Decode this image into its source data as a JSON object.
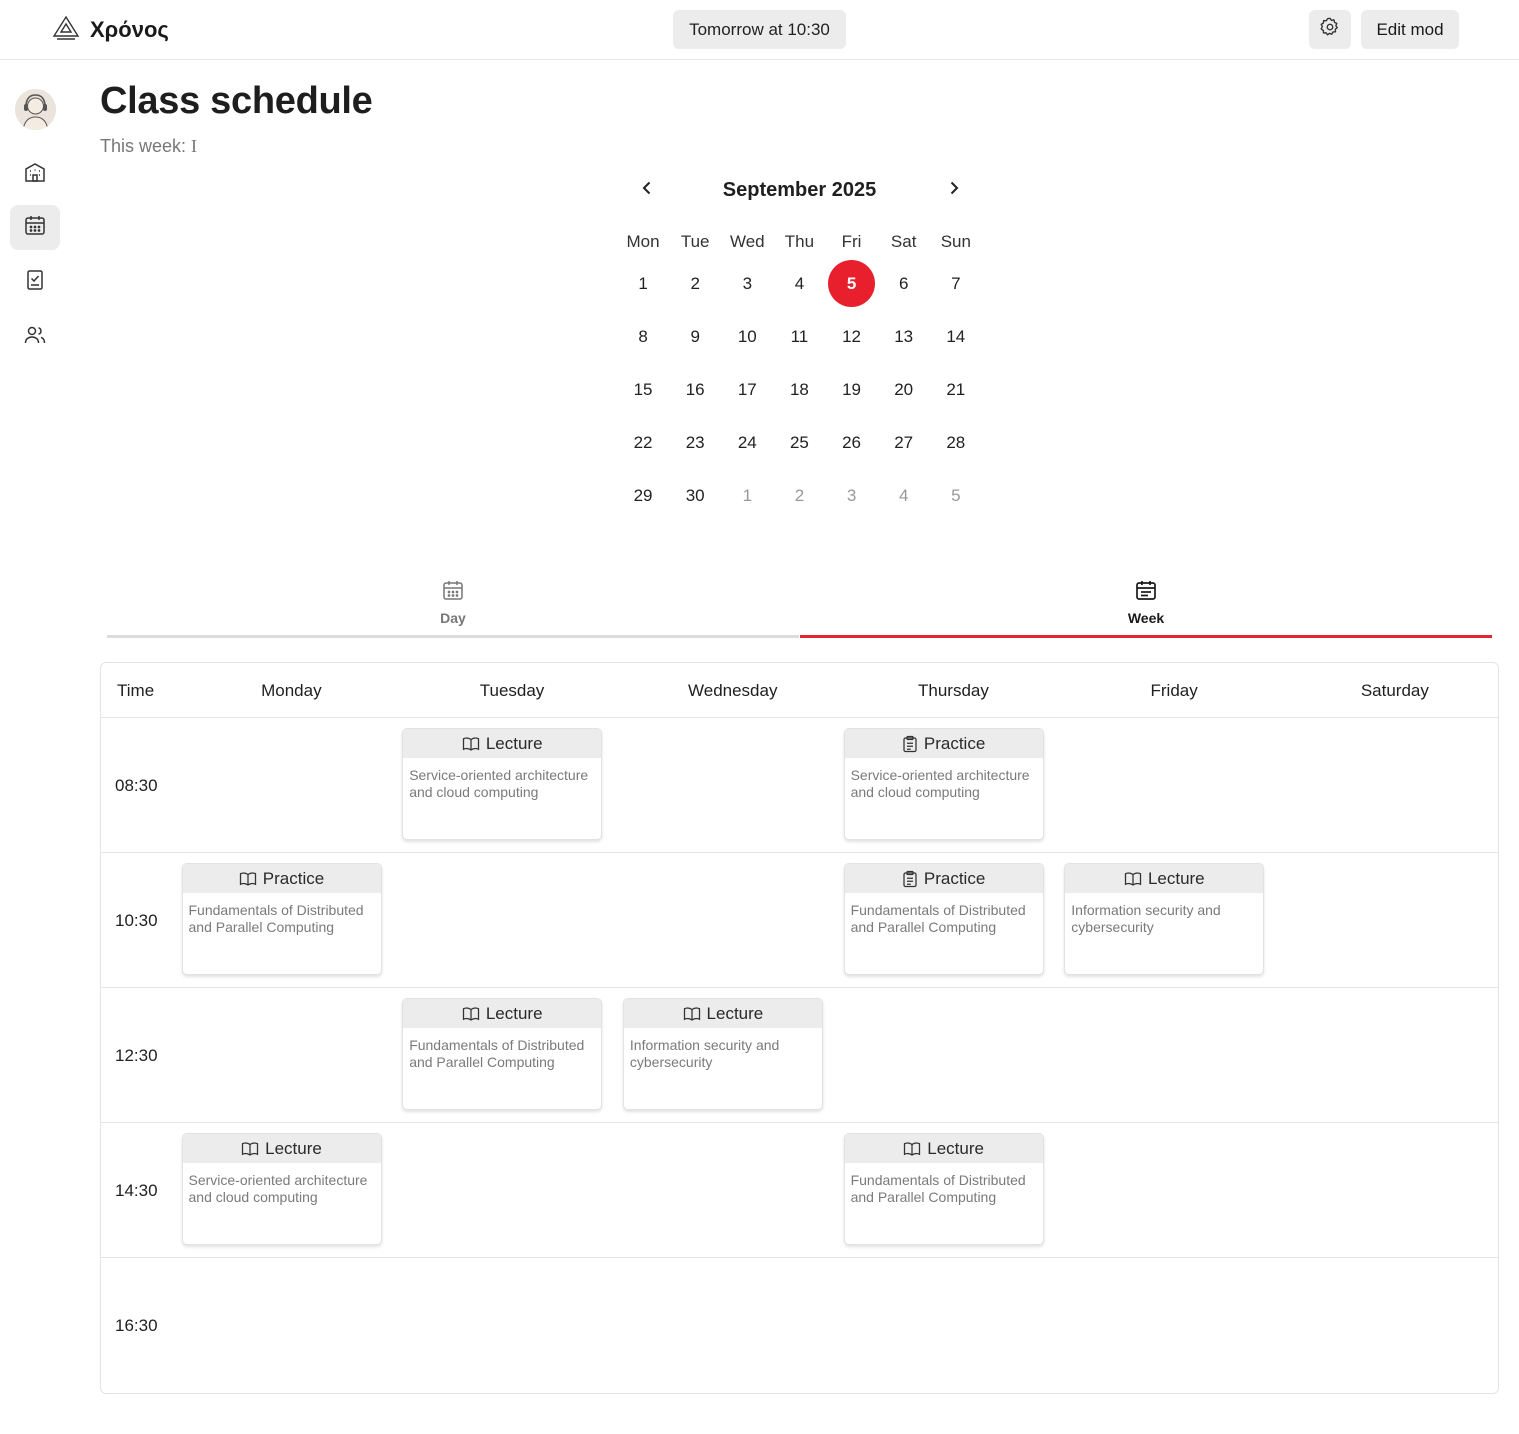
{
  "header": {
    "brand": "Χρόνος",
    "next_class": "Tomorrow at 10:30",
    "edit_label": "Edit mod"
  },
  "sidebar": {
    "items": [
      {
        "name": "buildings",
        "icon": "building-icon",
        "active": false
      },
      {
        "name": "schedule",
        "icon": "calendar-icon",
        "active": true
      },
      {
        "name": "tasks",
        "icon": "checklist-icon",
        "active": false
      },
      {
        "name": "people",
        "icon": "users-icon",
        "active": false
      }
    ]
  },
  "page": {
    "title": "Class schedule",
    "week_label": "This week:",
    "week_value": "I"
  },
  "calendar": {
    "month": "September 2025",
    "weekdays": [
      "Mon",
      "Tue",
      "Wed",
      "Thu",
      "Fri",
      "Sat",
      "Sun"
    ],
    "weeks": [
      [
        "1",
        "2",
        "3",
        "4",
        "5",
        "6",
        "7"
      ],
      [
        "8",
        "9",
        "10",
        "11",
        "12",
        "13",
        "14"
      ],
      [
        "15",
        "16",
        "17",
        "18",
        "19",
        "20",
        "21"
      ],
      [
        "22",
        "23",
        "24",
        "25",
        "26",
        "27",
        "28"
      ],
      [
        "29",
        "30",
        "1",
        "2",
        "3",
        "4",
        "5"
      ]
    ],
    "today": "5",
    "accent": "#e8202d"
  },
  "tabs": [
    {
      "label": "Day",
      "icon": "calendar-grid-icon",
      "active": false
    },
    {
      "label": "Week",
      "icon": "calendar-list-icon",
      "active": true
    }
  ],
  "schedule": {
    "time_header": "Time",
    "days": [
      "Monday",
      "Tuesday",
      "Wednesday",
      "Thursday",
      "Friday",
      "Saturday"
    ],
    "slots": [
      "08:30",
      "10:30",
      "12:30",
      "14:30",
      "16:30"
    ],
    "classes": [
      {
        "slot": 0,
        "day": 1,
        "type": "Lecture",
        "icon": "book-icon",
        "subject": "Service-oriented architecture and cloud computing"
      },
      {
        "slot": 0,
        "day": 3,
        "type": "Practice",
        "icon": "clipboard-icon",
        "subject": "Service-oriented architecture and cloud computing"
      },
      {
        "slot": 1,
        "day": 0,
        "type": "Practice",
        "icon": "book-icon",
        "subject": "Fundamentals of Distributed and Parallel Computing"
      },
      {
        "slot": 1,
        "day": 3,
        "type": "Practice",
        "icon": "clipboard-icon",
        "subject": "Fundamentals of Distributed and Parallel Computing"
      },
      {
        "slot": 1,
        "day": 4,
        "type": "Lecture",
        "icon": "book-icon",
        "subject": "Information security and cybersecurity"
      },
      {
        "slot": 2,
        "day": 1,
        "type": "Lecture",
        "icon": "book-icon",
        "subject": "Fundamentals of Distributed and Parallel Computing"
      },
      {
        "slot": 2,
        "day": 2,
        "type": "Lecture",
        "icon": "book-icon",
        "subject": "Information security and cybersecurity"
      },
      {
        "slot": 3,
        "day": 0,
        "type": "Lecture",
        "icon": "book-icon",
        "subject": "Service-oriented architecture and cloud computing"
      },
      {
        "slot": 3,
        "day": 3,
        "type": "Lecture",
        "icon": "book-icon",
        "subject": "Fundamentals of Distributed and Parallel Computing"
      }
    ]
  }
}
